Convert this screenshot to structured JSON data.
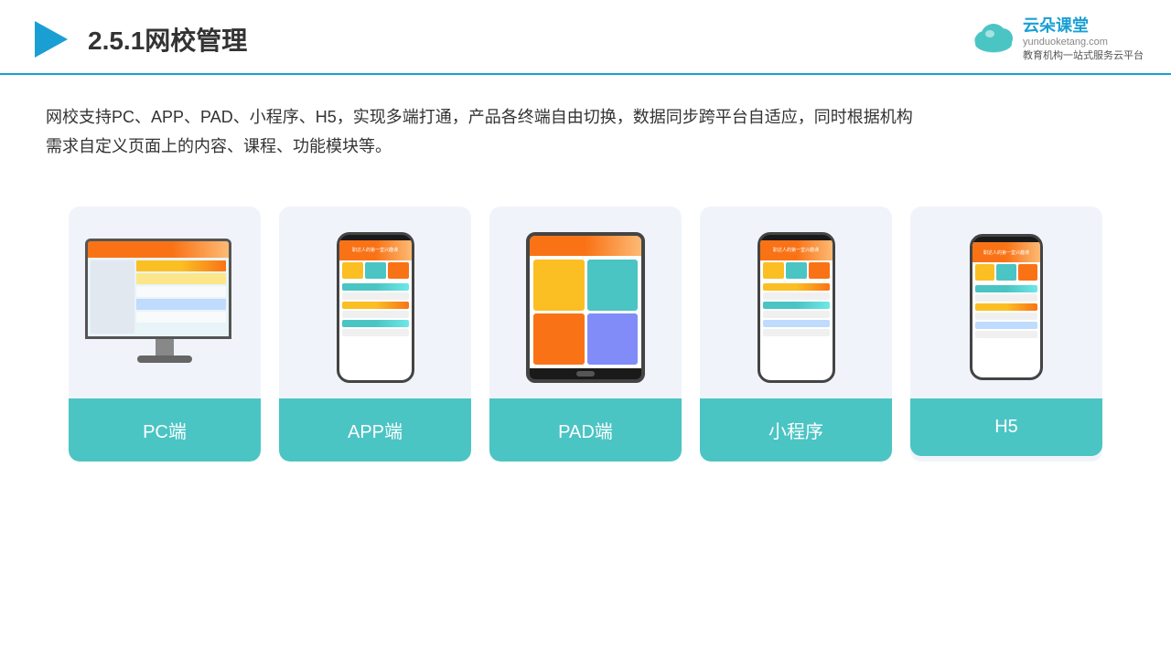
{
  "header": {
    "title": "2.5.1网校管理",
    "brand_name": "云朵课堂",
    "brand_url": "yunduoketang.com",
    "brand_tagline": "教育机构一站\n式服务云平台"
  },
  "description": {
    "text": "网校支持PC、APP、PAD、小程序、H5，实现多端打通，产品各终端自由切换，数据同步跨平台自适应，同时根据机构需求自定义页面上的内容、课程、功能模块等。"
  },
  "cards": [
    {
      "label": "PC端",
      "device": "pc"
    },
    {
      "label": "APP端",
      "device": "phone"
    },
    {
      "label": "PAD端",
      "device": "tablet"
    },
    {
      "label": "小程序",
      "device": "phone2"
    },
    {
      "label": "H5",
      "device": "phone3"
    }
  ]
}
